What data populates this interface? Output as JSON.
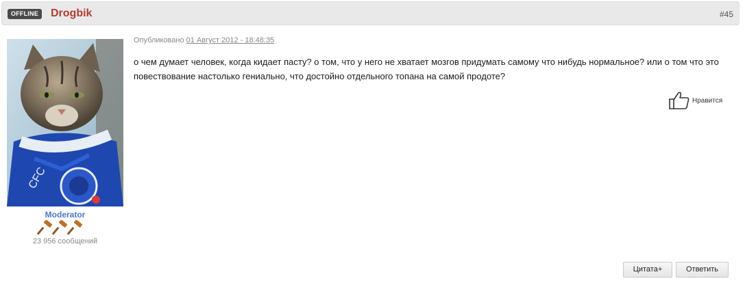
{
  "header": {
    "status": "OFFLINE",
    "author": "Drogbik",
    "post_number": "#45"
  },
  "author_panel": {
    "role": "Moderator",
    "post_count": "23 956 сообщений",
    "rank_icons": [
      "gavel-icon",
      "gavel-icon",
      "gavel-icon"
    ]
  },
  "post": {
    "published_label": "Опубликовано",
    "published_date": "01 Август 2012 - 18:48:35",
    "body": "о чем думает человек, когда кидает пасту? о том, что у него не хватает мозгов придумать самому что нибудь нормальное? или о том что это повествование настолько гениально, что достойно отдельного топана на самой продоте?"
  },
  "like": {
    "label": "Нравится",
    "icon": "thumbs-up-icon"
  },
  "actions": {
    "quote_label": "Цитата+",
    "reply_label": "Ответить"
  },
  "colors": {
    "author": "#b23c2e",
    "role": "#4a76c8",
    "badge_bg": "#4a4a4a",
    "header_bg": "#e9e9e9"
  }
}
